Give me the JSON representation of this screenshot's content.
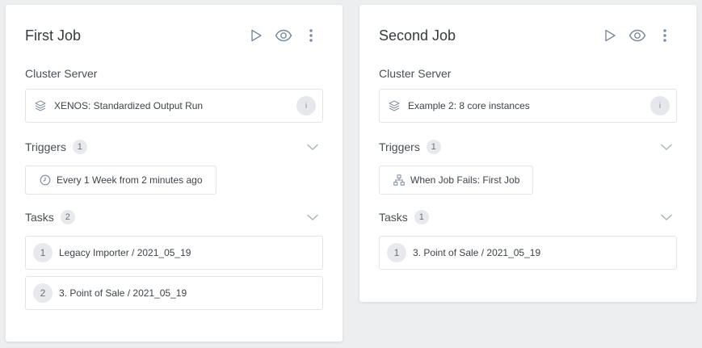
{
  "colors": {
    "background": "#eceef0",
    "card": "#ffffff",
    "border": "#e2e5e8",
    "icon": "#7a8a9a",
    "badge": "#e7e9ec"
  },
  "jobs": [
    {
      "title": "First Job",
      "actions": [
        "play-icon",
        "eye-icon",
        "more-vertical-icon"
      ],
      "cluster_label": "Cluster Server",
      "cluster_value": "XENOS: Standardized Output Run",
      "cluster_info": "i",
      "triggers_label": "Triggers",
      "triggers_count": "1",
      "triggers": [
        {
          "icon": "clock-icon",
          "label": "Every 1 Week from 2 minutes ago"
        }
      ],
      "tasks_label": "Tasks",
      "tasks_count": "2",
      "tasks": [
        {
          "num": "1",
          "label": "Legacy Importer / 2021_05_19"
        },
        {
          "num": "2",
          "label": "3. Point of Sale / 2021_05_19"
        }
      ]
    },
    {
      "title": "Second Job",
      "actions": [
        "play-icon",
        "eye-icon",
        "more-vertical-icon"
      ],
      "cluster_label": "Cluster Server",
      "cluster_value": "Example 2: 8 core instances",
      "cluster_info": "i",
      "triggers_label": "Triggers",
      "triggers_count": "1",
      "triggers": [
        {
          "icon": "hierarchy-icon",
          "label": "When Job Fails: First Job"
        }
      ],
      "tasks_label": "Tasks",
      "tasks_count": "1",
      "tasks": [
        {
          "num": "1",
          "label": "3. Point of Sale / 2021_05_19"
        }
      ]
    }
  ]
}
